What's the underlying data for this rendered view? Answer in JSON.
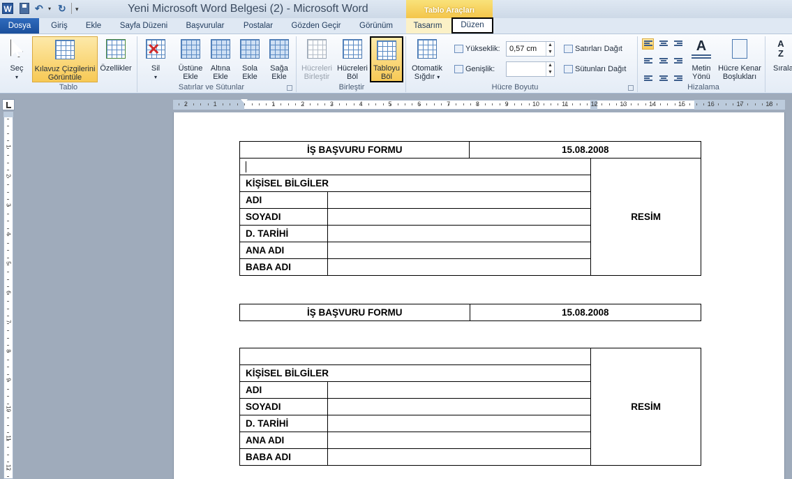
{
  "title_bar": {
    "title": "Yeni Microsoft Word Belgesi (2)  -  Microsoft Word",
    "app_icon_letter": "W",
    "contextual_title": "Tablo Araçları"
  },
  "tabs": [
    {
      "label": "Dosya"
    },
    {
      "label": "Giriş"
    },
    {
      "label": "Ekle"
    },
    {
      "label": "Sayfa Düzeni"
    },
    {
      "label": "Başvurular"
    },
    {
      "label": "Postalar"
    },
    {
      "label": "Gözden Geçir"
    },
    {
      "label": "Görünüm"
    },
    {
      "label": "Tasarım"
    },
    {
      "label": "Düzen"
    }
  ],
  "ribbon": {
    "tablo": {
      "group_label": "Tablo",
      "sec": "Seç",
      "kilavuz_1": "Kılavuz Çizgilerini",
      "kilavuz_2": "Görüntüle",
      "ozellikler": "Özellikler"
    },
    "satirlar": {
      "group_label": "Satırlar ve Sütunlar",
      "sil": "Sil",
      "ustune_1": "Üstüne",
      "ustune_2": "Ekle",
      "altina_1": "Altına",
      "altina_2": "Ekle",
      "sola_1": "Sola",
      "sola_2": "Ekle",
      "saga_1": "Sağa",
      "saga_2": "Ekle"
    },
    "birlestir": {
      "group_label": "Birleştir",
      "hucreleri_birlestir_1": "Hücreleri",
      "hucreleri_birlestir_2": "Birleştir",
      "hucreleri_bol_1": "Hücreleri",
      "hucreleri_bol_2": "Böl",
      "tabloyu_bol_1": "Tabloyu",
      "tabloyu_bol_2": "Böl"
    },
    "hucre_boyutu": {
      "group_label": "Hücre Boyutu",
      "otomatik_1": "Otomatik",
      "otomatik_2": "Sığdır",
      "yukseklik_label": "Yükseklik:",
      "yukseklik_value": "0,57 cm",
      "genislik_label": "Genişlik:",
      "genislik_value": "",
      "satirlari_dagit": "Satırları Dağıt",
      "sutunlari_dagit": "Sütunları Dağıt"
    },
    "hizalama": {
      "group_label": "Hizalama",
      "metin_1": "Metin",
      "metin_2": "Yönü",
      "kenar_1": "Hücre Kenar",
      "kenar_2": "Boşlukları",
      "sirala": "Sırala",
      "az_glyph": "A Z"
    }
  },
  "ruler": {
    "h_numbers": [
      "2",
      "1",
      "1",
      "2",
      "3",
      "4",
      "5",
      "6",
      "7",
      "8",
      "9",
      "10",
      "11",
      "12",
      "13",
      "14",
      "15",
      "16",
      "17",
      "18"
    ],
    "v_numbers": [
      "1",
      "2",
      "3",
      "4",
      "5",
      "6",
      "7",
      "8",
      "9",
      "10",
      "11",
      "12"
    ]
  },
  "document": {
    "table1": {
      "header_title": "İŞ BAŞVURU FORMU",
      "header_date": "15.08.2008",
      "section": "KİŞİSEL BİLGİLER",
      "photo": "RESİM",
      "fields": [
        "ADI",
        "SOYADI",
        "D. TARİHİ",
        "ANA ADI",
        "BABA ADI"
      ]
    },
    "table2": {
      "header_title": "İŞ BAŞVURU FORMU",
      "header_date": "15.08.2008"
    },
    "table3": {
      "section": "KİŞİSEL BİLGİLER",
      "photo": "RESİM",
      "fields": [
        "ADI",
        "SOYADI",
        "D. TARİHİ",
        "ANA ADI",
        "BABA ADI"
      ]
    }
  }
}
